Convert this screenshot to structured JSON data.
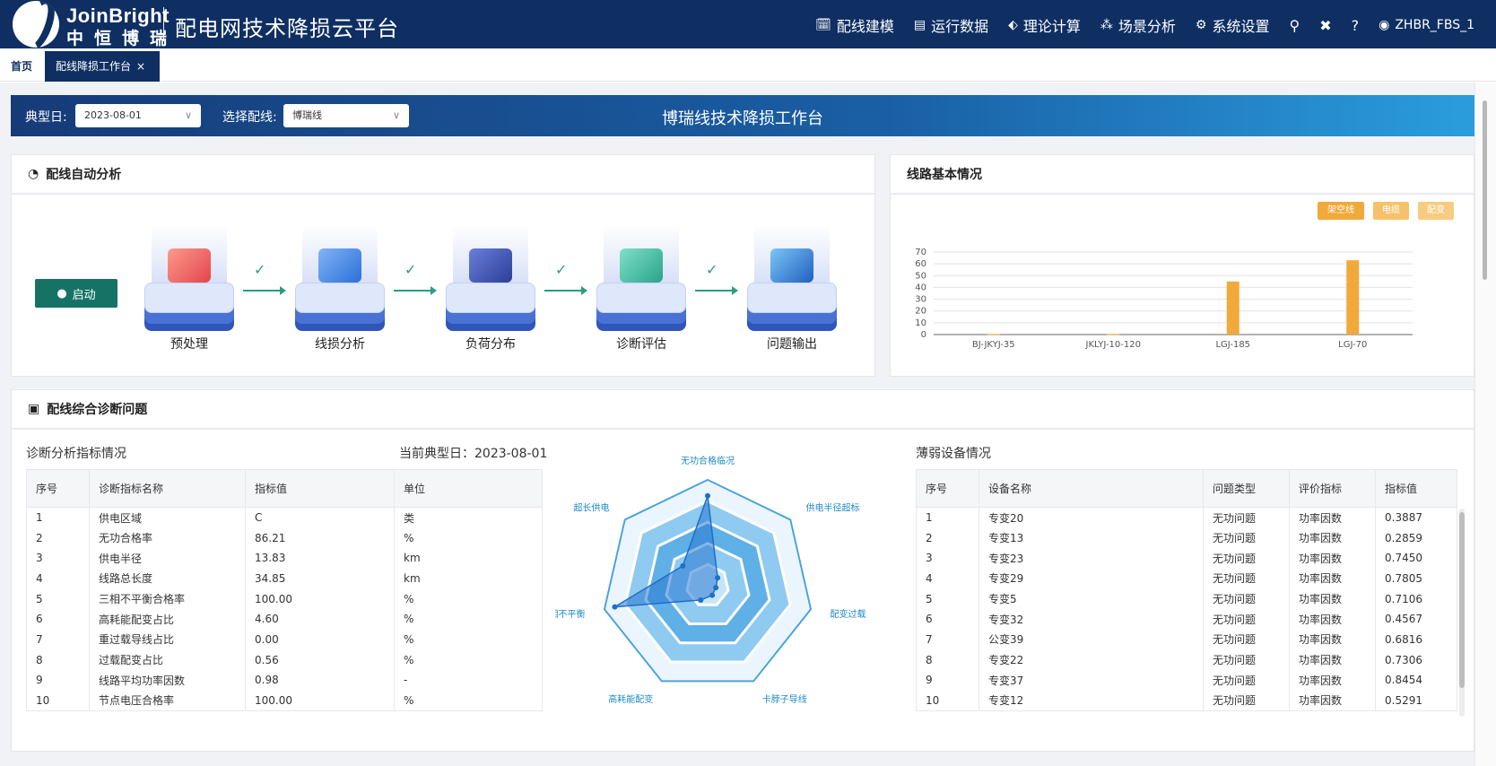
{
  "header": {
    "logo_en": "JoinBright",
    "logo_cn": "中恒博瑞",
    "app_title": "配电网技术降损云平台",
    "nav": [
      {
        "label": "配线建模",
        "icon": "calendar-icon",
        "glyph": "🗓"
      },
      {
        "label": "运行数据",
        "icon": "table-icon",
        "glyph": "▤"
      },
      {
        "label": "理论计算",
        "icon": "tag-icon",
        "glyph": "⬖"
      },
      {
        "label": "场景分析",
        "icon": "cubes-icon",
        "glyph": "⁂"
      },
      {
        "label": "系统设置",
        "icon": "cogs-icon",
        "glyph": "⚙"
      }
    ],
    "tool_search": "⚲",
    "tool_tools": "✖",
    "tool_help": "?",
    "user": "ZHBR_FBS_1",
    "user_glyph": "◉"
  },
  "tabs": {
    "home": "首页",
    "active": "配线降损工作台",
    "close": "×"
  },
  "filters": {
    "day_label": "典型日:",
    "day_value": "2023-08-01",
    "line_label": "选择配线:",
    "line_value": "博瑞线",
    "arrow": "∨",
    "title": "博瑞线技术降损工作台"
  },
  "auto_analysis": {
    "title": "配线自动分析",
    "title_glyph": "◔",
    "start_label": "启动",
    "start_glyph": "●",
    "check": "✓",
    "steps": [
      "预处理",
      "线损分析",
      "负荷分布",
      "诊断评估",
      "问题输出"
    ]
  },
  "line_basics": {
    "title": "线路基本情况",
    "legend": [
      {
        "label": "架空线",
        "color": "#f0a93a"
      },
      {
        "label": "电缆",
        "color": "#f5c26b"
      },
      {
        "label": "配变",
        "color": "#f7cb80"
      }
    ]
  },
  "chart_data": {
    "type": "bar",
    "categories": [
      "BJ-JKYJ-35",
      "JKLYJ-10-120",
      "LGJ-185",
      "LGJ-70"
    ],
    "values": [
      0.5,
      0.5,
      45,
      63
    ],
    "ylim": [
      0,
      70
    ],
    "yticks": [
      "0",
      "10",
      "20",
      "30",
      "40",
      "50",
      "60",
      "70"
    ],
    "grid": true,
    "legend_position": "top-right",
    "bar_color": "#f2a93b"
  },
  "diagnosis": {
    "title": "配线综合诊断问题",
    "title_glyph": "▣",
    "indicators": {
      "subtitle": "诊断分析指标情况",
      "typical_day": "当前典型日：2023-08-01",
      "headers": [
        "序号",
        "诊断指标名称",
        "指标值",
        "单位"
      ],
      "rows": [
        [
          "1",
          "供电区域",
          "C",
          "类"
        ],
        [
          "2",
          "无功合格率",
          "86.21",
          "%"
        ],
        [
          "3",
          "供电半径",
          "13.83",
          "km"
        ],
        [
          "4",
          "线路总长度",
          "34.85",
          "km"
        ],
        [
          "5",
          "三相不平衡合格率",
          "100.00",
          "%"
        ],
        [
          "6",
          "高耗能配变占比",
          "4.60",
          "%"
        ],
        [
          "7",
          "重过载导线占比",
          "0.00",
          "%"
        ],
        [
          "8",
          "过载配变占比",
          "0.56",
          "%"
        ],
        [
          "9",
          "线路平均功率因数",
          "0.98",
          "-"
        ],
        [
          "10",
          "节点电压合格率",
          "100.00",
          "%"
        ]
      ]
    },
    "radar": {
      "axes": [
        "无功合格临况",
        "供电半径超标",
        "配变过载",
        "卡脖子导线",
        "高耗能配变",
        "三相不平衡",
        "超长供电"
      ],
      "values": [
        0.85,
        0.12,
        0.08,
        0.1,
        0.15,
        0.9,
        0.3
      ],
      "max": 1
    },
    "weak_devices": {
      "subtitle": "薄弱设备情况",
      "headers": [
        "序号",
        "设备名称",
        "问题类型",
        "评价指标",
        "指标值"
      ],
      "rows": [
        [
          "1",
          "专变20",
          "无功问题",
          "功率因数",
          "0.3887"
        ],
        [
          "2",
          "专变13",
          "无功问题",
          "功率因数",
          "0.2859"
        ],
        [
          "3",
          "专变23",
          "无功问题",
          "功率因数",
          "0.7450"
        ],
        [
          "4",
          "专变29",
          "无功问题",
          "功率因数",
          "0.7805"
        ],
        [
          "5",
          "专变5",
          "无功问题",
          "功率因数",
          "0.7106"
        ],
        [
          "6",
          "专变32",
          "无功问题",
          "功率因数",
          "0.4567"
        ],
        [
          "7",
          "公变39",
          "无功问题",
          "功率因数",
          "0.6816"
        ],
        [
          "8",
          "专变22",
          "无功问题",
          "功率因数",
          "0.7306"
        ],
        [
          "9",
          "专变37",
          "无功问题",
          "功率因数",
          "0.8454"
        ],
        [
          "10",
          "专变12",
          "无功问题",
          "功率因数",
          "0.5291"
        ]
      ]
    }
  },
  "colors": {
    "header_bg": "#0f2f63",
    "accent_green": "#177266",
    "check_green": "#2a9c84",
    "bar_orange": "#f2a93b",
    "radar_blue": "#1e88c8"
  }
}
